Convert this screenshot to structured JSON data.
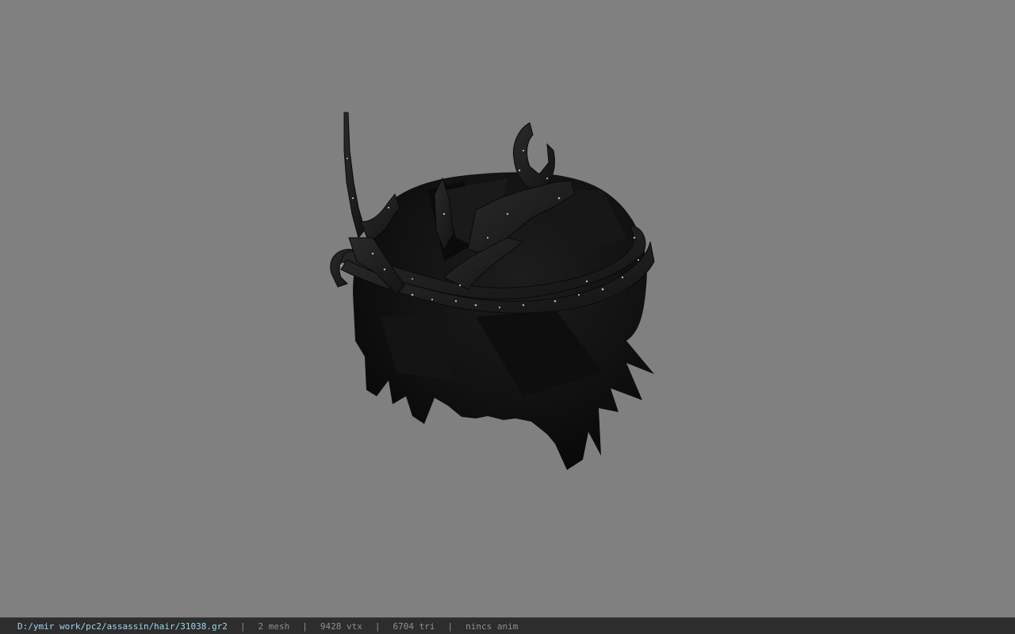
{
  "viewport": {
    "background": "#808080",
    "model": "hair mesh with thorn crown"
  },
  "status_bar": {
    "file_path": "D:/ymir work/pc2/assassin/hair/31038.gr2",
    "meshes": "2 mesh",
    "vertices": "9428 vtx",
    "triangles": "6704 tri",
    "animation": "nincs anim",
    "path_color": "#9fd6f2",
    "text_color": "#8f8f8f",
    "background": "#2d2d2d"
  }
}
